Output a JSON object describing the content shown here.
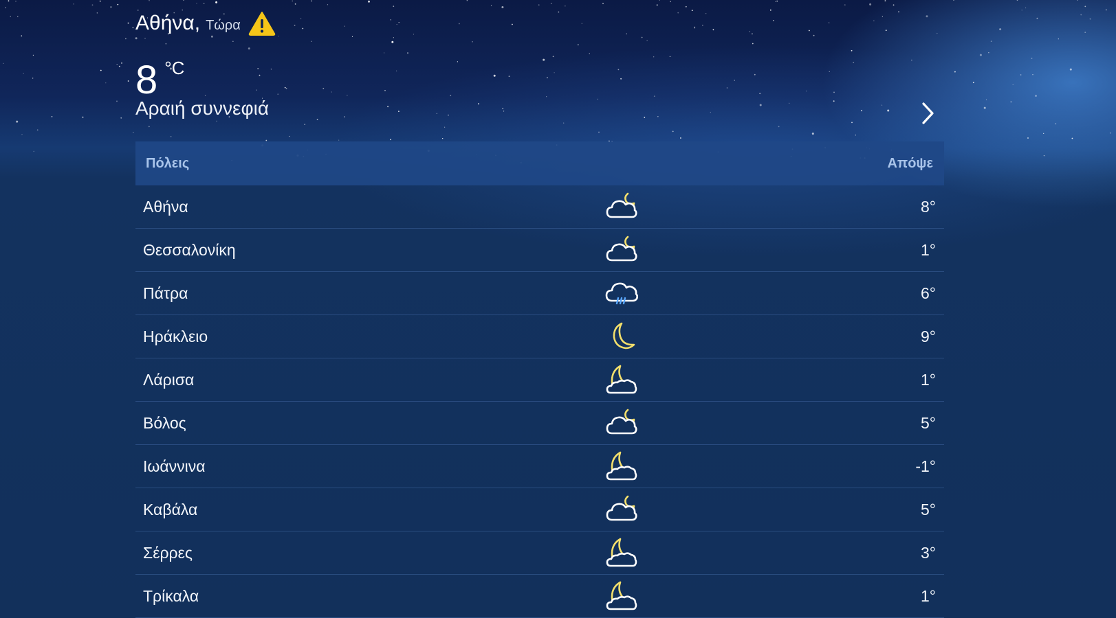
{
  "header": {
    "city": "Αθήνα,",
    "time_label": "Τώρα",
    "warning_icon": "warning-triangle-icon",
    "temperature": "8",
    "unit": "°C",
    "condition": "Αραιή συννεφιά",
    "next_icon": "chevron-right-icon"
  },
  "table": {
    "columns": [
      "Πόλεις",
      "Απόψε"
    ],
    "rows": [
      {
        "city": "Αθήνα",
        "icon": "cloud-moon",
        "temp": "8°"
      },
      {
        "city": "Θεσσαλονίκη",
        "icon": "cloud-moon",
        "temp": "1°"
      },
      {
        "city": "Πάτρα",
        "icon": "cloud-rain",
        "temp": "6°"
      },
      {
        "city": "Ηράκλειο",
        "icon": "moon",
        "temp": "9°"
      },
      {
        "city": "Λάρισα",
        "icon": "moon-cloud",
        "temp": "1°"
      },
      {
        "city": "Βόλος",
        "icon": "cloud-moon",
        "temp": "5°"
      },
      {
        "city": "Ιωάννινα",
        "icon": "moon-cloud",
        "temp": "-1°"
      },
      {
        "city": "Καβάλα",
        "icon": "cloud-moon",
        "temp": "5°"
      },
      {
        "city": "Σέρρες",
        "icon": "moon-cloud",
        "temp": "3°"
      },
      {
        "city": "Τρίκαλα",
        "icon": "moon-cloud",
        "temp": "1°"
      }
    ]
  },
  "colors": {
    "background": "#12305b",
    "header_bar": "#204887",
    "header_text": "#a9c4ea",
    "icon_white": "#ffffff",
    "icon_yellow": "#f3df6c",
    "icon_blue": "#5aa8ff",
    "warning": "#f5c518"
  }
}
